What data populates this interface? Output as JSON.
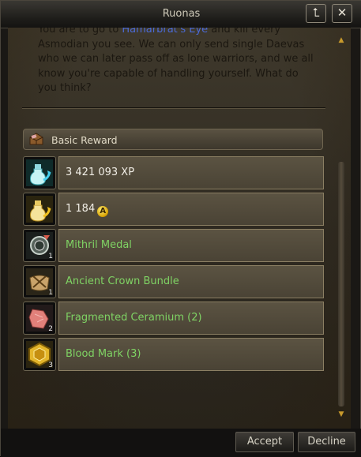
{
  "window": {
    "title": "Ruonas"
  },
  "titlebar_buttons": {
    "restore_icon": "restore-icon",
    "close_icon": "close-icon",
    "restore_glyph": "⮤",
    "close_glyph": "✕"
  },
  "dialog": {
    "line1_prefix": "You are to go to ",
    "line1_highlight": "Hamarbrat's Eye",
    "line1_suffix": " and kill every",
    "line2": "Asmodian you see. We can only send single Daevas",
    "line3": "who we can later pass off as lone warriors, and we all",
    "line4": "know you're capable of handling yourself. What do",
    "line5": "you think?"
  },
  "reward_section": {
    "header_label": "Basic Reward",
    "header_icon": "treasure-chest-icon",
    "items": [
      {
        "label": "3 421 093 XP",
        "icon": "exp-potion-icon",
        "quantity": "",
        "color": "white"
      },
      {
        "label": "1 184",
        "icon": "abyss-potion-icon",
        "quantity": "",
        "color": "white",
        "currency_symbol": "A"
      },
      {
        "label": "Mithril Medal",
        "icon": "mithril-medal-icon",
        "quantity": "1",
        "color": "green"
      },
      {
        "label": "Ancient Crown Bundle",
        "icon": "crown-bundle-icon",
        "quantity": "1",
        "color": "green"
      },
      {
        "label": "Fragmented Ceramium (2)",
        "icon": "ceramium-icon",
        "quantity": "2",
        "color": "green"
      },
      {
        "label": "Blood Mark (3)",
        "icon": "blood-mark-icon",
        "quantity": "3",
        "color": "green"
      }
    ]
  },
  "buttons": {
    "accept": "Accept",
    "decline": "Decline"
  },
  "colors": {
    "item_green": "#7fd364",
    "highlight_blue": "#4b6ad6",
    "scroll_arrow": "#c89a2c"
  }
}
